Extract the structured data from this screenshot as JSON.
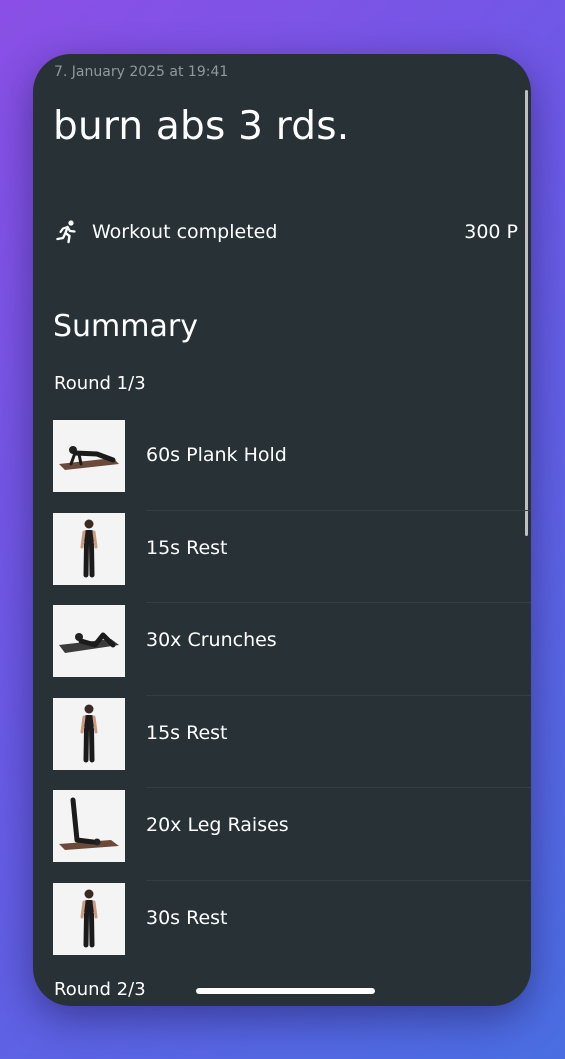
{
  "header": {
    "date": "7. January 2025 at 19:41",
    "title": "burn abs 3 rds."
  },
  "status": {
    "icon": "running-person-icon",
    "label": "Workout completed",
    "points": "300 P"
  },
  "summary": {
    "title": "Summary",
    "rounds": [
      {
        "label": "Round 1/3",
        "exercises": [
          {
            "label": "60s Plank Hold",
            "image": "plank"
          },
          {
            "label": "15s Rest",
            "image": "standing"
          },
          {
            "label": "30x Crunches",
            "image": "crunch"
          },
          {
            "label": "15s Rest",
            "image": "standing"
          },
          {
            "label": "20x Leg Raises",
            "image": "legraise"
          },
          {
            "label": "30s Rest",
            "image": "standing"
          }
        ]
      },
      {
        "label": "Round 2/3",
        "exercises": []
      }
    ]
  },
  "colors": {
    "background": "#283236",
    "text": "#ffffff",
    "muted": "#8f9a9e"
  }
}
